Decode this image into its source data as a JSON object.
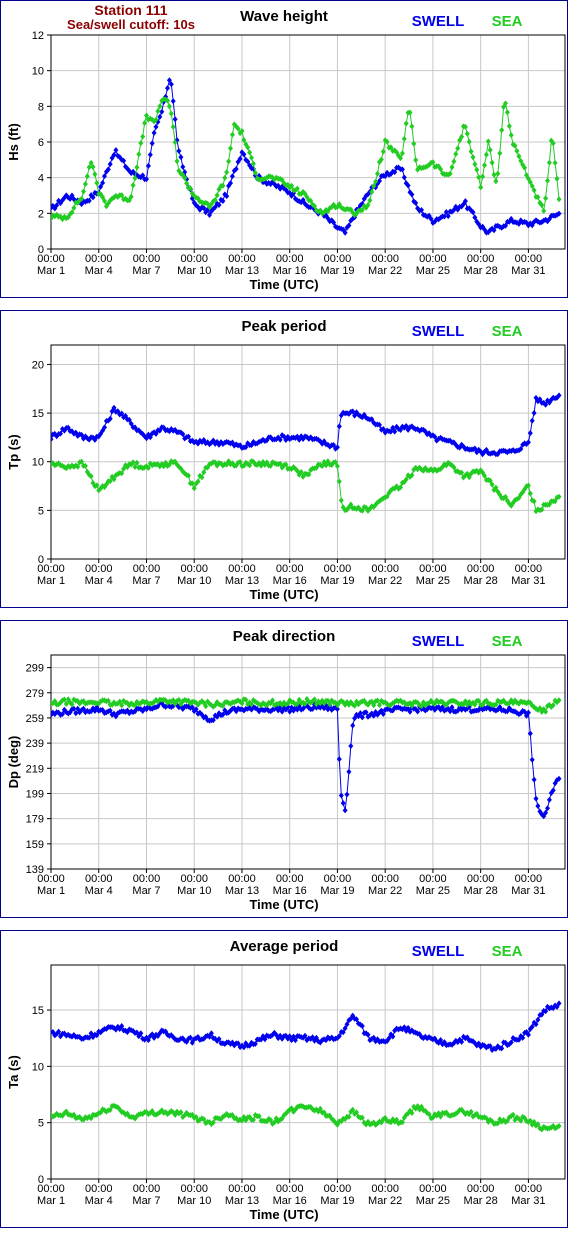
{
  "station": {
    "name": "Station 111",
    "cutoff": "Sea/swell cutoff: 10s"
  },
  "legend": {
    "swell": "SWELL",
    "sea": "SEA"
  },
  "colors": {
    "swell": "#0000ee",
    "sea": "#22cc22",
    "border": "#00008b",
    "title": "#8b0000"
  },
  "x_axis": {
    "label": "Time (UTC)",
    "range_days": [
      0,
      32.3
    ],
    "ticks": [
      {
        "day": 0,
        "time": "00:00",
        "date": "Mar 1"
      },
      {
        "day": 3,
        "time": "00:00",
        "date": "Mar 4"
      },
      {
        "day": 6,
        "time": "00:00",
        "date": "Mar 7"
      },
      {
        "day": 9,
        "time": "00:00",
        "date": "Mar 10"
      },
      {
        "day": 12,
        "time": "00:00",
        "date": "Mar 13"
      },
      {
        "day": 15,
        "time": "00:00",
        "date": "Mar 16"
      },
      {
        "day": 18,
        "time": "00:00",
        "date": "Mar 19"
      },
      {
        "day": 21,
        "time": "00:00",
        "date": "Mar 22"
      },
      {
        "day": 24,
        "time": "00:00",
        "date": "Mar 25"
      },
      {
        "day": 27,
        "time": "00:00",
        "date": "Mar 28"
      },
      {
        "day": 30,
        "time": "00:00",
        "date": "Mar 31"
      }
    ]
  },
  "chart_data": [
    {
      "type": "line",
      "title": "Wave height",
      "ylabel": "Hs (ft)",
      "ylim": [
        0,
        12
      ],
      "yticks": [
        0,
        2,
        4,
        6,
        8,
        10,
        12
      ],
      "grid": true,
      "legend_position": "top-right",
      "series": [
        {
          "name": "SWELL",
          "x": [
            0,
            1,
            2,
            3,
            4,
            5,
            6,
            6.5,
            7,
            7.5,
            8,
            9,
            10,
            11,
            12,
            13,
            14,
            15,
            16,
            17,
            18,
            18.5,
            19,
            20,
            21,
            22,
            23,
            24,
            25,
            26,
            27,
            27.5,
            28,
            29,
            30,
            31,
            32
          ],
          "values": [
            2.2,
            3.0,
            2.6,
            3.2,
            5.5,
            4.3,
            4.0,
            6.5,
            7.8,
            9.8,
            5.5,
            2.5,
            2.0,
            3.0,
            5.5,
            4.0,
            3.6,
            3.2,
            2.5,
            2.0,
            1.2,
            0.9,
            1.8,
            3.2,
            4.2,
            4.5,
            2.3,
            1.6,
            2.0,
            2.6,
            1.3,
            0.9,
            1.2,
            1.6,
            1.4,
            1.6,
            2.0
          ]
        },
        {
          "name": "SEA",
          "x": [
            0,
            1,
            2,
            2.5,
            3,
            3.5,
            4,
            5,
            6,
            6.5,
            7,
            7.5,
            8,
            9,
            10,
            11,
            11.5,
            12,
            13,
            14,
            15,
            16,
            17,
            18,
            19,
            20,
            21,
            22,
            22.5,
            23,
            24,
            25,
            26,
            27,
            27.5,
            28,
            28.5,
            29,
            30,
            31,
            31.5,
            32
          ],
          "values": [
            1.8,
            1.8,
            3.0,
            5.0,
            3.2,
            2.5,
            3.0,
            2.8,
            7.5,
            7.0,
            8.5,
            8.0,
            4.5,
            3.0,
            2.3,
            4.0,
            7.0,
            6.5,
            4.0,
            4.0,
            3.5,
            3.0,
            2.0,
            2.5,
            2.0,
            2.5,
            6.0,
            5.0,
            8.0,
            4.5,
            4.8,
            4.0,
            7.0,
            3.5,
            6.0,
            3.5,
            8.5,
            6.0,
            4.0,
            2.0,
            6.5,
            2.0
          ]
        }
      ]
    },
    {
      "type": "scatter",
      "title": "Peak period",
      "ylabel": "Tp (s)",
      "ylim": [
        0,
        22
      ],
      "yticks": [
        0,
        5,
        10,
        15,
        20
      ],
      "grid": true,
      "legend_position": "top-right",
      "series": [
        {
          "name": "SWELL",
          "x": [
            0,
            1,
            2,
            3,
            4,
            5,
            6,
            7,
            8,
            9,
            10,
            11,
            12,
            13,
            14,
            15,
            16,
            17,
            18,
            18.2,
            19,
            20,
            21,
            22,
            23,
            24,
            25,
            26,
            27,
            28,
            29,
            30,
            30.5,
            31,
            32
          ],
          "values": [
            12.5,
            13.5,
            12.5,
            12.5,
            15.5,
            14.0,
            12.5,
            13.5,
            13.0,
            12.0,
            12.0,
            12.0,
            11.5,
            12.0,
            12.5,
            12.5,
            12.5,
            12.0,
            11.5,
            15.0,
            15.0,
            14.5,
            13.0,
            13.5,
            13.5,
            12.5,
            12.0,
            11.5,
            11.0,
            11.0,
            11.0,
            12.0,
            16.5,
            16.0,
            17.0
          ]
        },
        {
          "name": "SEA",
          "x": [
            0,
            1,
            2,
            3,
            4,
            5,
            6,
            7,
            8,
            9,
            10,
            11,
            12,
            13,
            14,
            15,
            16,
            17,
            18,
            18.3,
            19,
            20,
            21,
            22,
            23,
            24,
            25,
            26,
            27,
            28,
            29,
            30,
            30.5,
            31,
            32
          ],
          "values": [
            9.8,
            9.5,
            9.8,
            7.0,
            8.5,
            9.8,
            9.5,
            9.8,
            9.8,
            7.5,
            9.8,
            9.8,
            9.8,
            9.8,
            9.8,
            9.5,
            8.5,
            9.8,
            9.8,
            5.0,
            5.5,
            5.0,
            6.5,
            7.5,
            9.5,
            9.0,
            9.8,
            8.5,
            9.0,
            7.0,
            5.5,
            7.5,
            5.0,
            5.5,
            6.5
          ]
        }
      ]
    },
    {
      "type": "scatter",
      "title": "Peak direction",
      "ylabel": "Dp (deg)",
      "ylim": [
        139,
        309
      ],
      "yticks": [
        139,
        159,
        179,
        199,
        219,
        239,
        259,
        279,
        299
      ],
      "grid": true,
      "legend_position": "top-right",
      "series": [
        {
          "name": "SWELL",
          "x": [
            0,
            1,
            2,
            3,
            4,
            5,
            6,
            7,
            8,
            9,
            10,
            11,
            12,
            13,
            14,
            15,
            16,
            17,
            18,
            18.2,
            18.5,
            19,
            20,
            21,
            22,
            23,
            24,
            25,
            26,
            27,
            28,
            29,
            30,
            30.5,
            31,
            31.5,
            32
          ],
          "values": [
            262,
            264,
            265,
            266,
            262,
            264,
            266,
            270,
            268,
            266,
            258,
            264,
            266,
            266,
            266,
            266,
            267,
            268,
            266,
            200,
            185,
            260,
            262,
            264,
            266,
            266,
            266,
            266,
            266,
            266,
            266,
            265,
            262,
            190,
            180,
            200,
            215
          ]
        },
        {
          "name": "SEA",
          "x": [
            0,
            1,
            2,
            3,
            4,
            5,
            6,
            7,
            8,
            9,
            10,
            11,
            12,
            13,
            14,
            15,
            16,
            17,
            18,
            19,
            20,
            21,
            22,
            23,
            24,
            25,
            26,
            27,
            28,
            29,
            30,
            31,
            32
          ],
          "values": [
            270,
            272,
            271,
            272,
            270,
            271,
            271,
            273,
            272,
            271,
            270,
            270,
            272,
            271,
            271,
            271,
            272,
            272,
            271,
            270,
            271,
            271,
            271,
            270,
            271,
            271,
            271,
            271,
            271,
            271,
            270,
            265,
            275
          ]
        }
      ]
    },
    {
      "type": "line",
      "title": "Average period",
      "ylabel": "Ta (s)",
      "ylim": [
        0,
        19
      ],
      "yticks": [
        0,
        5,
        10,
        15
      ],
      "grid": true,
      "legend_position": "top-right",
      "series": [
        {
          "name": "SWELL",
          "x": [
            0,
            1,
            2,
            3,
            4,
            5,
            6,
            7,
            8,
            9,
            10,
            11,
            12,
            13,
            14,
            15,
            16,
            17,
            18,
            19,
            20,
            21,
            22,
            23,
            24,
            25,
            26,
            27,
            28,
            29,
            30,
            31,
            32
          ],
          "values": [
            13.0,
            12.8,
            12.5,
            13.0,
            13.5,
            13.2,
            12.5,
            13.0,
            12.5,
            12.3,
            12.8,
            12.0,
            11.8,
            12.3,
            12.8,
            12.5,
            12.5,
            12.3,
            12.5,
            14.5,
            12.5,
            12.3,
            13.5,
            12.8,
            12.3,
            12.0,
            12.5,
            11.8,
            11.6,
            12.3,
            13.0,
            15.0,
            15.5
          ]
        },
        {
          "name": "SEA",
          "x": [
            0,
            1,
            2,
            3,
            4,
            5,
            6,
            7,
            8,
            9,
            10,
            11,
            12,
            13,
            14,
            15,
            16,
            17,
            18,
            19,
            20,
            21,
            22,
            23,
            24,
            25,
            26,
            27,
            28,
            29,
            30,
            31,
            32
          ],
          "values": [
            5.5,
            5.8,
            5.3,
            5.8,
            6.5,
            5.5,
            5.8,
            6.0,
            5.8,
            5.5,
            5.0,
            5.8,
            5.3,
            5.5,
            5.0,
            6.0,
            6.5,
            6.0,
            5.0,
            6.0,
            4.8,
            5.2,
            5.0,
            6.5,
            5.5,
            5.8,
            6.0,
            5.5,
            5.0,
            5.5,
            5.2,
            4.5,
            4.5
          ]
        }
      ]
    }
  ]
}
